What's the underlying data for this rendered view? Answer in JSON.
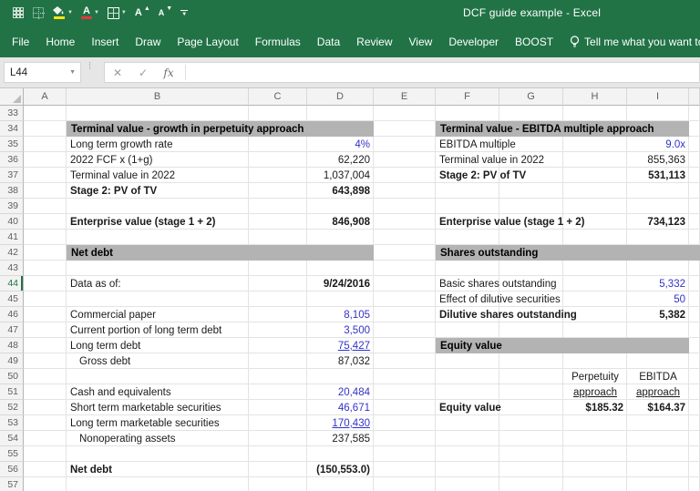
{
  "titlebar": {
    "title": "DCF guide example  -  Excel"
  },
  "qat": {
    "buttons": [
      {
        "name": "grid-style-1-button",
        "icon": "dotted-grid-icon"
      },
      {
        "name": "grid-style-2-button",
        "icon": "dotted-grid-icon"
      },
      {
        "name": "fill-color-button",
        "icon": "paint-bucket-icon",
        "color": "#f3e612"
      },
      {
        "name": "font-color-button",
        "icon": "letter-a-icon",
        "color": "#e03a3a",
        "glyph": "A"
      },
      {
        "name": "borders-button",
        "icon": "borders-grid-icon"
      },
      {
        "name": "increase-font-button",
        "icon": "grow-font-icon",
        "glyph": "A"
      },
      {
        "name": "decrease-font-button",
        "icon": "shrink-font-icon",
        "glyph": "A"
      },
      {
        "name": "customize-qat-button",
        "icon": "caret-down-icon"
      }
    ]
  },
  "ribbon": {
    "tabs": [
      "File",
      "Home",
      "Insert",
      "Draw",
      "Page Layout",
      "Formulas",
      "Data",
      "Review",
      "View",
      "Developer",
      "BOOST"
    ],
    "tell_me": "Tell me what you want to d"
  },
  "formula_bar": {
    "name_box": "L44",
    "cancel_glyph": "✕",
    "enter_glyph": "✓",
    "fx_glyph": "fx",
    "formula": ""
  },
  "grid": {
    "columns": [
      "A",
      "B",
      "C",
      "D",
      "E",
      "F",
      "G",
      "H",
      "I",
      ""
    ],
    "row_start": 33,
    "row_end": 57,
    "active_row": 44,
    "sections": [
      {
        "row": 34,
        "from": "B",
        "to": "D",
        "label": "Terminal value - growth in perpetuity approach"
      },
      {
        "row": 34,
        "from": "F",
        "to": "I",
        "label": "Terminal value - EBITDA multiple approach"
      },
      {
        "row": 42,
        "from": "B",
        "to": "D",
        "label": "Net debt"
      },
      {
        "row": 42,
        "from": "F",
        "to": "J",
        "label": "Shares outstanding"
      },
      {
        "row": 48,
        "from": "F",
        "to": "I",
        "label": "Equity value"
      }
    ],
    "cells": [
      {
        "r": 35,
        "c": "B",
        "t": "Long term growth rate"
      },
      {
        "r": 35,
        "c": "D",
        "t": "4%",
        "right": true,
        "blue": true
      },
      {
        "r": 36,
        "c": "B",
        "t": "2022 FCF x (1+g)"
      },
      {
        "r": 36,
        "c": "D",
        "t": "62,220",
        "right": true
      },
      {
        "r": 37,
        "c": "B",
        "t": "Terminal value in 2022"
      },
      {
        "r": 37,
        "c": "D",
        "t": "1,037,004",
        "right": true
      },
      {
        "r": 38,
        "c": "B",
        "t": "Stage 2: PV of TV",
        "bold": true
      },
      {
        "r": 38,
        "c": "D",
        "t": "643,898",
        "right": true,
        "bold": true
      },
      {
        "r": 40,
        "c": "B",
        "t": "Enterprise value (stage 1 + 2)",
        "bold": true
      },
      {
        "r": 40,
        "c": "D",
        "t": "846,908",
        "right": true,
        "bold": true
      },
      {
        "r": 44,
        "c": "B",
        "t": "Data as of:"
      },
      {
        "r": 44,
        "c": "D",
        "t": "9/24/2016",
        "right": true,
        "bold": true
      },
      {
        "r": 46,
        "c": "B",
        "t": "Commercial paper"
      },
      {
        "r": 46,
        "c": "D",
        "t": "8,105",
        "right": true,
        "blue": true
      },
      {
        "r": 47,
        "c": "B",
        "t": "Current portion of long term debt"
      },
      {
        "r": 47,
        "c": "D",
        "t": "3,500",
        "right": true,
        "blue": true
      },
      {
        "r": 48,
        "c": "B",
        "t": "Long term debt"
      },
      {
        "r": 48,
        "c": "D",
        "t": "75,427",
        "right": true,
        "blue": true,
        "u": true
      },
      {
        "r": 49,
        "c": "B",
        "t": "Gross debt",
        "indent": true
      },
      {
        "r": 49,
        "c": "D",
        "t": "87,032",
        "right": true
      },
      {
        "r": 51,
        "c": "B",
        "t": "Cash and equivalents"
      },
      {
        "r": 51,
        "c": "D",
        "t": "20,484",
        "right": true,
        "blue": true
      },
      {
        "r": 52,
        "c": "B",
        "t": "Short term marketable securities"
      },
      {
        "r": 52,
        "c": "D",
        "t": "46,671",
        "right": true,
        "blue": true
      },
      {
        "r": 53,
        "c": "B",
        "t": "Long term marketable securities"
      },
      {
        "r": 53,
        "c": "D",
        "t": "170,430",
        "right": true,
        "blue": true,
        "u": true
      },
      {
        "r": 54,
        "c": "B",
        "t": "Nonoperating assets",
        "indent": true
      },
      {
        "r": 54,
        "c": "D",
        "t": "237,585",
        "right": true
      },
      {
        "r": 56,
        "c": "B",
        "t": "Net debt",
        "bold": true
      },
      {
        "r": 56,
        "c": "D",
        "t": "(150,553.0)",
        "right": true,
        "bold": true
      },
      {
        "r": 35,
        "c": "F",
        "t": "EBITDA multiple"
      },
      {
        "r": 35,
        "c": "I",
        "t": "9.0x",
        "right": true,
        "blue": true
      },
      {
        "r": 36,
        "c": "F",
        "t": "Terminal value in 2022"
      },
      {
        "r": 36,
        "c": "I",
        "t": "855,363",
        "right": true
      },
      {
        "r": 37,
        "c": "F",
        "t": "Stage 2: PV of TV",
        "bold": true
      },
      {
        "r": 37,
        "c": "I",
        "t": "531,113",
        "right": true,
        "bold": true
      },
      {
        "r": 40,
        "c": "F",
        "t": "Enterprise value (stage 1 + 2)",
        "bold": true
      },
      {
        "r": 40,
        "c": "I",
        "t": "734,123",
        "right": true,
        "bold": true
      },
      {
        "r": 44,
        "c": "F",
        "t": "Basic shares outstanding"
      },
      {
        "r": 44,
        "c": "I",
        "t": "5,332",
        "right": true,
        "blue": true
      },
      {
        "r": 45,
        "c": "F",
        "t": "Effect of dilutive securities"
      },
      {
        "r": 45,
        "c": "I",
        "t": "50",
        "right": true,
        "blue": true
      },
      {
        "r": 46,
        "c": "F",
        "t": "Dilutive shares outstanding",
        "bold": true
      },
      {
        "r": 46,
        "c": "I",
        "t": "5,382",
        "right": true,
        "bold": true
      },
      {
        "r": 50,
        "c": "H",
        "t": "Perpetuity",
        "center": true
      },
      {
        "r": 50,
        "c": "I",
        "t": "EBITDA",
        "center": true
      },
      {
        "r": 51,
        "c": "H",
        "t": "approach",
        "center": true,
        "u": true
      },
      {
        "r": 51,
        "c": "I",
        "t": "approach",
        "center": true,
        "u": true
      },
      {
        "r": 52,
        "c": "F",
        "t": "Equity value",
        "bold": true
      },
      {
        "r": 52,
        "c": "H",
        "t": "$185.32",
        "right": true,
        "bold": true
      },
      {
        "r": 52,
        "c": "I",
        "t": "$164.37",
        "right": true,
        "bold": true
      }
    ]
  },
  "colors": {
    "excel_green": "#217346",
    "section_gray": "#b3b3b3",
    "input_blue": "#3232c8",
    "fill_swatch_yellow": "#f3e612",
    "font_swatch_red": "#e03a3a"
  }
}
